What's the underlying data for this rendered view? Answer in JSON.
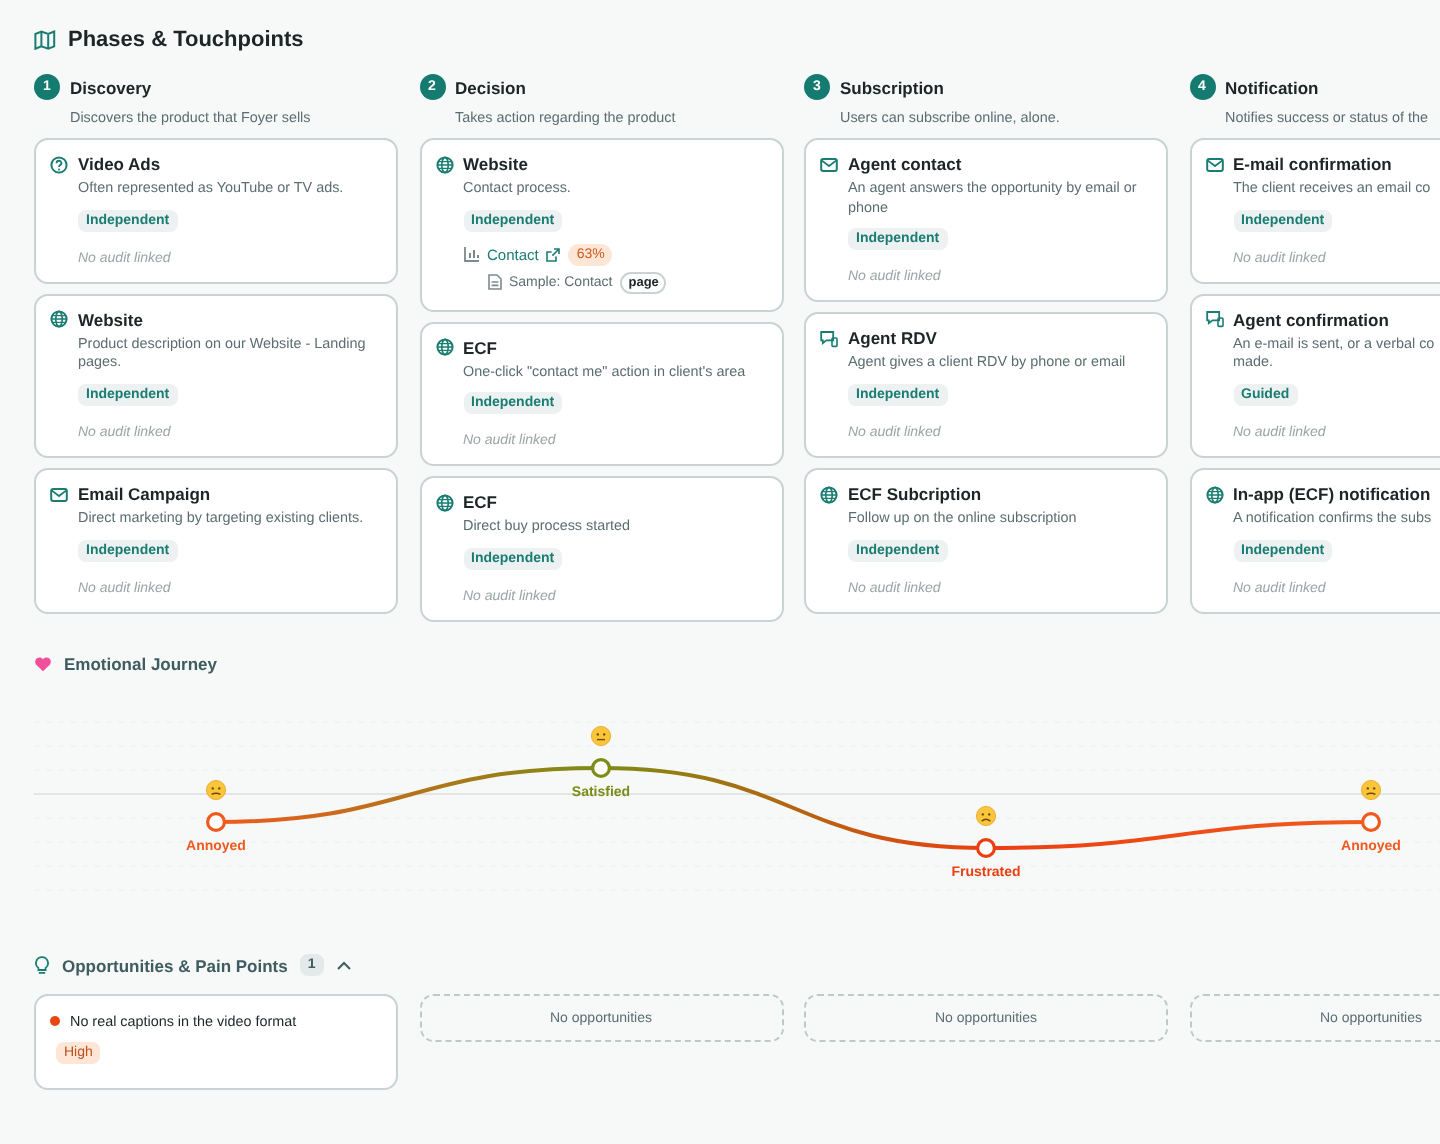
{
  "section_title": "Phases & Touchpoints",
  "phases": [
    {
      "number": "1",
      "name": "Discovery",
      "description": "Discovers the product that Foyer sells",
      "touchpoints": [
        {
          "kind": "question",
          "title": "Video Ads",
          "description": "Often represented as YouTube or TV ads.",
          "tag": "Independent",
          "audit_note": "No audit linked"
        },
        {
          "kind": "globe",
          "title": "Website",
          "description": "Product description on our Website - Landing pages.",
          "tag": "Independent",
          "audit_note": "No audit linked"
        },
        {
          "kind": "mail",
          "title": "Email Campaign",
          "description": "Direct marketing by targeting existing clients.",
          "tag": "Independent",
          "audit_note": "No audit linked"
        }
      ]
    },
    {
      "number": "2",
      "name": "Decision",
      "description": "Takes action regarding the product",
      "touchpoints": [
        {
          "kind": "globe",
          "title": "Website",
          "description": "Contact process.",
          "tag": "Independent",
          "audit": {
            "link": "Contact",
            "score": "63%",
            "sample": "Sample: Contact",
            "sample_type": "page"
          }
        },
        {
          "kind": "globe",
          "title": "ECF",
          "description": "One-click \"contact me\" action in client's area",
          "tag": "Independent",
          "audit_note": "No audit linked"
        },
        {
          "kind": "globe",
          "title": "ECF",
          "description": "Direct buy process started",
          "tag": "Independent",
          "audit_note": "No audit linked"
        }
      ]
    },
    {
      "number": "3",
      "name": "Subscription",
      "description": "Users can subscribe online, alone.",
      "touchpoints": [
        {
          "kind": "mail",
          "title": "Agent contact",
          "description": "An agent answers the opportunity by email or phone",
          "tag": "Independent",
          "audit_note": "No audit linked"
        },
        {
          "kind": "chat",
          "title": "Agent RDV",
          "description": "Agent gives a client RDV by phone or email",
          "tag": "Independent",
          "audit_note": "No audit linked"
        },
        {
          "kind": "globe",
          "title": "ECF Subcription",
          "description": "Follow up on the online subscription",
          "tag": "Independent",
          "audit_note": "No audit linked"
        }
      ]
    },
    {
      "number": "4",
      "name": "Notification",
      "description": "Notifies success or status of the",
      "touchpoints": [
        {
          "kind": "mail",
          "title": "E-mail confirmation",
          "description": "The client receives an email co",
          "tag": "Independent",
          "audit_note": "No audit linked"
        },
        {
          "kind": "chat",
          "title": "Agent confirmation",
          "description": "An e-mail is sent, or a verbal co\nmade.",
          "tag": "Guided",
          "audit_note": "No audit linked"
        },
        {
          "kind": "globe",
          "title": "In-app (ECF) notification",
          "description": "A notification confirms the subs",
          "tag": "Independent",
          "audit_note": "No audit linked"
        }
      ]
    }
  ],
  "emotional_journey": {
    "title": "Emotional Journey",
    "points": [
      {
        "kind": "annoyed",
        "mood": "Annoyed",
        "color": "#f05a1e"
      },
      {
        "kind": "satisfied",
        "mood": "Satisfied",
        "color": "#7c8c14"
      },
      {
        "kind": "frustrated",
        "mood": "Frustrated",
        "color": "#ec3f10"
      },
      {
        "kind": "annoyed",
        "mood": "Annoyed",
        "color": "#f05a1e"
      }
    ]
  },
  "opportunities": {
    "title": "Opportunities & Pain Points",
    "count": "1",
    "expanded": true,
    "columns": [
      {
        "items": [
          {
            "text": "No real captions in the video format",
            "priority": "High",
            "color": "#e8470f"
          }
        ]
      },
      {
        "empty_text": "No opportunities"
      },
      {
        "empty_text": "No opportunities"
      },
      {
        "empty_text": "No opportunities"
      }
    ]
  }
}
